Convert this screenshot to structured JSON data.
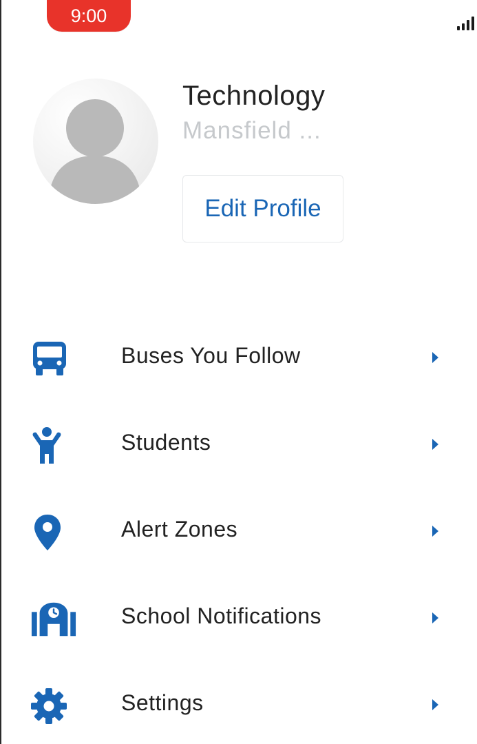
{
  "status_bar": {
    "time": "9:00",
    "time_color": "#e8332a"
  },
  "profile": {
    "name": "Technology",
    "subtitle": "Mansfield ...",
    "edit_label": "Edit Profile",
    "avatar_icon": "default-user-avatar"
  },
  "accent_color": "#1a66b5",
  "menu": {
    "items": [
      {
        "label": "Buses You Follow",
        "icon": "bus-icon"
      },
      {
        "label": "Students",
        "icon": "student-icon"
      },
      {
        "label": "Alert Zones",
        "icon": "map-pin-icon"
      },
      {
        "label": "School Notifications",
        "icon": "school-icon"
      },
      {
        "label": "Settings",
        "icon": "gear-icon"
      }
    ]
  }
}
